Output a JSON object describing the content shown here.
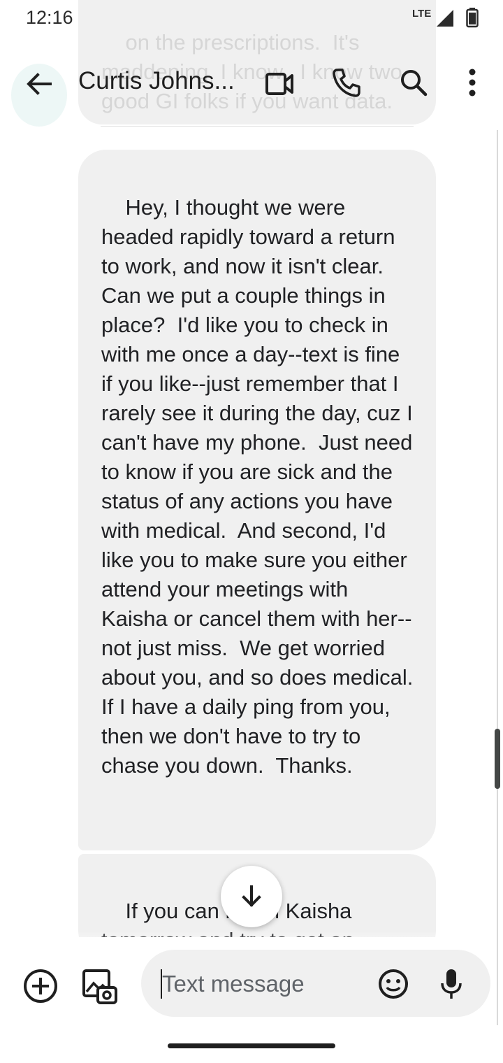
{
  "status_bar": {
    "time": "12:16",
    "network": "LTE",
    "battery_icon": "battery-icon",
    "signal_icon": "signal-icon"
  },
  "header": {
    "contact_name": "Curtis Johns...",
    "back_icon": "back-arrow-icon",
    "video_icon": "video-call-icon",
    "call_icon": "phone-icon",
    "search_icon": "search-icon",
    "more_icon": "more-vertical-icon"
  },
  "conversation": {
    "previous_message": "on the prescriptions.  It's maddening, I know.  I know two good GI folks if you want data.",
    "main_message": "Hey, I thought we were headed rapidly toward a return to work, and now it isn't clear.  Can we put a couple things in place?  I'd like you to check in with me once a day--text is fine if you like--just remember that I rarely see it during the day, cuz I can't have my phone.  Just need to know if you are sick and the status of any actions you have with medical.  And second, I'd like you to make sure you either attend your meetings with Kaisha or cancel them with her--not just miss.  We get worried about you, and so does medical.  If I have a daily ping from you, then we don't have to try to chase you down.  Thanks.",
    "next_message": "If you can reach Kaisha tomorrow and try to get an appointment with her for l",
    "scroll_down_icon": "arrow-down-icon"
  },
  "compose": {
    "placeholder": "Text message",
    "add_icon": "add-circle-icon",
    "gallery_icon": "gallery-icon",
    "emoji_icon": "emoji-icon",
    "mic_icon": "microphone-icon"
  },
  "colors": {
    "bubble": "#f0f0f0",
    "text": "#202124",
    "icon": "#2b2b2b"
  }
}
